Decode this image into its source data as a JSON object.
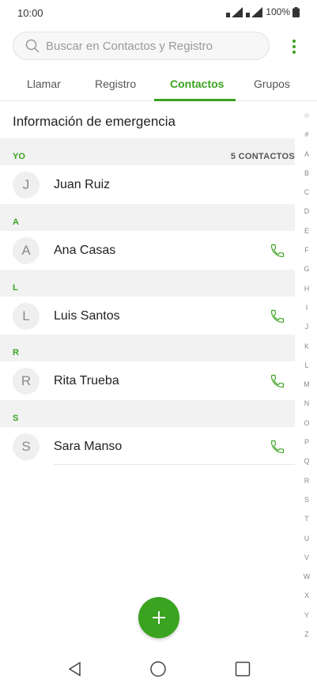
{
  "status": {
    "time": "10:00",
    "battery": "100%"
  },
  "search": {
    "placeholder": "Buscar en Contactos y Registro"
  },
  "tabs": [
    {
      "label": "Llamar"
    },
    {
      "label": "Registro"
    },
    {
      "label": "Contactos"
    },
    {
      "label": "Grupos"
    }
  ],
  "emergency": {
    "label": "Información de emergencia"
  },
  "sections": [
    {
      "letter": "YO",
      "count": "5 CONTACTOS",
      "contacts": [
        {
          "initial": "J",
          "name": "Juan Ruiz"
        }
      ]
    },
    {
      "letter": "A",
      "contacts": [
        {
          "initial": "A",
          "name": "Ana Casas"
        }
      ]
    },
    {
      "letter": "L",
      "contacts": [
        {
          "initial": "L",
          "name": "Luis Santos"
        }
      ]
    },
    {
      "letter": "R",
      "contacts": [
        {
          "initial": "R",
          "name": "Rita Trueba"
        }
      ]
    },
    {
      "letter": "S",
      "contacts": [
        {
          "initial": "S",
          "name": "Sara Manso"
        }
      ]
    }
  ],
  "index": [
    "☆",
    "#",
    "A",
    "B",
    "C",
    "D",
    "E",
    "F",
    "G",
    "H",
    "I",
    "J",
    "K",
    "L",
    "M",
    "N",
    "O",
    "P",
    "Q",
    "R",
    "S",
    "T",
    "U",
    "V",
    "W",
    "X",
    "Y",
    "Z"
  ],
  "colors": {
    "accent": "#3aa31f"
  }
}
